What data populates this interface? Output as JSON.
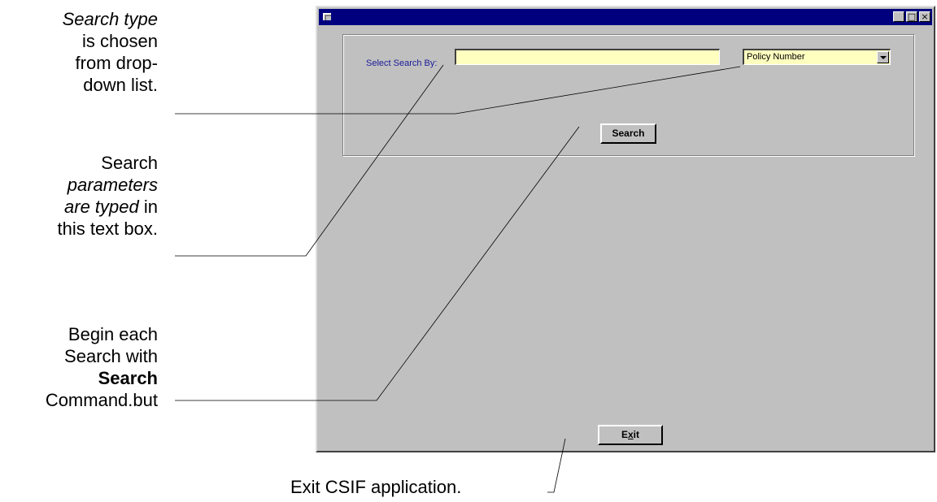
{
  "annotations": {
    "search_type": {
      "l1": "Search type",
      "l2": "is chosen",
      "l3": "from drop-",
      "l4": "down list."
    },
    "parameters": {
      "l1": "Search",
      "l2": "parameters",
      "l3a": "are typed",
      "l3b": " in",
      "l4": "this text box."
    },
    "search_cmd": {
      "l1": "Begin each",
      "l2": "Search with",
      "l3": "Search",
      "l4": "Command.but"
    },
    "exit": "Exit CSIF application."
  },
  "form": {
    "select_label": "Select Search By:",
    "search_value": "",
    "search_type_selected": "Policy Number",
    "search_button": "Search",
    "exit_button_pre": "E",
    "exit_button_ul": "x",
    "exit_button_post": "it"
  },
  "window_controls": {
    "minimize": "_",
    "maximize": "□",
    "close": "×"
  },
  "colors": {
    "titlebar": "#00007f",
    "window_bg": "#c0c0c0",
    "input_bg": "#ffffc0",
    "label_text": "#1a1a9a"
  }
}
